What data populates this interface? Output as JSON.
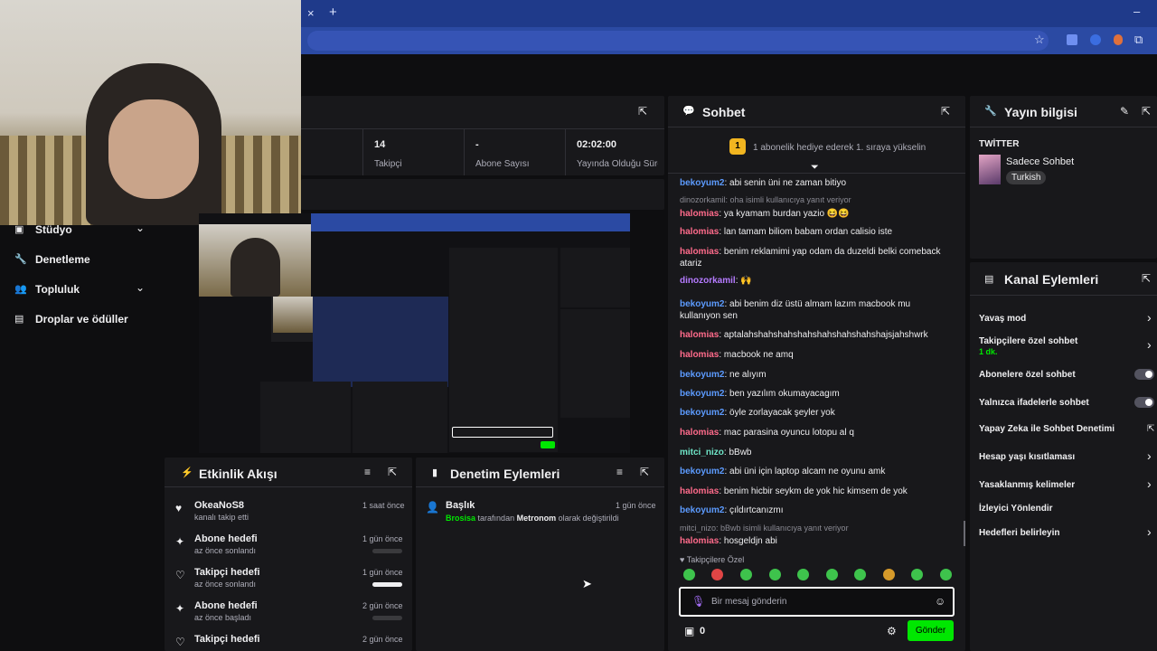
{
  "browser": {
    "close_tab": "×",
    "new_tab": "+",
    "minimize": "–"
  },
  "stats": [
    {
      "value": "14",
      "label": "Takipçi"
    },
    {
      "value": "-",
      "label": "Abone Sayısı"
    },
    {
      "value": "02:02:00",
      "label": "Yayında Olduğu Süre"
    }
  ],
  "sidebar": {
    "items": [
      {
        "label": "Stüdyo",
        "icon": "studio-icon",
        "has_chevron": true
      },
      {
        "label": "Denetleme",
        "icon": "wrench-icon",
        "has_chevron": false
      },
      {
        "label": "Topluluk",
        "icon": "community-icon",
        "has_chevron": true
      },
      {
        "label": "Droplar ve ödüller",
        "icon": "drops-icon",
        "has_chevron": false
      }
    ]
  },
  "activity": {
    "title": "Etkinlik Akışı",
    "items": [
      {
        "title": "OkeaNoS8",
        "sub": "kanalı takip etti",
        "time": "1 saat önce",
        "icon": "heart-icon",
        "progress": null
      },
      {
        "title": "Abone hedefi",
        "sub": "az önce sonlandı",
        "time": "1 gün önce",
        "icon": "sparkle-icon",
        "progress": 0
      },
      {
        "title": "Takipçi hedefi",
        "sub": "az önce sonlandı",
        "time": "1 gün önce",
        "icon": "heart-outline-icon",
        "progress": 1
      },
      {
        "title": "Abone hedefi",
        "sub": "az önce başladı",
        "time": "2 gün önce",
        "icon": "sparkle-icon",
        "progress": 0
      },
      {
        "title": "Takipçi hedefi",
        "sub": "",
        "time": "2 gün önce",
        "icon": "heart-outline-icon",
        "progress": null
      }
    ]
  },
  "moderation": {
    "title": "Denetim Eylemleri",
    "item": {
      "title": "Başlık",
      "user": "Brosisa",
      "text1": "tarafından",
      "user2": "Metronom",
      "text2": "olarak değiştirildi",
      "time": "1 gün önce"
    }
  },
  "chat": {
    "title": "Sohbet",
    "pinned_badge": "1",
    "pinned": "1 abonelik hediye ederek 1. sıraya yükselin",
    "lines": [
      {
        "user": "bekoyum2",
        "color": "#5c9bff",
        "text": "abi senin üni ne zaman bitiyo"
      },
      {
        "system": "dinozorkamil: oha isimli kullanıcıya yanıt veriyor"
      },
      {
        "user": "halomias",
        "color": "#ff6b8b",
        "text": "ya kyamam burdan yazio 😆😆"
      },
      {
        "user": "halomias",
        "color": "#ff6b8b",
        "text": "lan tamam biliom babam ordan calisio iste"
      },
      {
        "user": "halomias",
        "color": "#ff6b8b",
        "text": "benim reklamimi yap odam da duzeldi belki comeback atariz"
      },
      {
        "user": "dinozorkamil",
        "color": "#b57bff",
        "text": "🙌"
      },
      {
        "user": "bekoyum2",
        "color": "#5c9bff",
        "text": "abi benim diz üstü almam lazım macbook mu kullanıyon sen"
      },
      {
        "user": "halomias",
        "color": "#ff6b8b",
        "text": "aptalahshahshahshahshahshahshahshajsjahshwrk"
      },
      {
        "user": "halomias",
        "color": "#ff6b8b",
        "text": "macbook ne amq"
      },
      {
        "user": "bekoyum2",
        "color": "#5c9bff",
        "text": "ne alıyım"
      },
      {
        "user": "bekoyum2",
        "color": "#5c9bff",
        "text": "ben yazılım okumayacagım"
      },
      {
        "user": "bekoyum2",
        "color": "#5c9bff",
        "text": "öyle zorlayacak şeyler yok"
      },
      {
        "user": "halomias",
        "color": "#ff6b8b",
        "text": "mac parasina oyuncu lotopu al q"
      },
      {
        "user": "mitci_nizo",
        "color": "#6fe6c8",
        "text": "bBwb"
      },
      {
        "user": "bekoyum2",
        "color": "#5c9bff",
        "text": "abi üni için laptop alcam ne oyunu amk"
      },
      {
        "user": "halomias",
        "color": "#ff6b8b",
        "text": "benim hicbir seykm de yok hic kimsem de yok"
      },
      {
        "user": "bekoyum2",
        "color": "#5c9bff",
        "text": "çıldırtcanızmı"
      },
      {
        "system": "mitci_nizo: bBwb isimli kullanıcıya yanıt veriyor"
      },
      {
        "user": "halomias",
        "color": "#ff6b8b",
        "text": "hosgeldjn abi"
      }
    ],
    "emote_section": "Takipçilere Özel",
    "placeholder": "Bir mesaj gönderin",
    "points": "0",
    "send": "Gönder"
  },
  "stream_info": {
    "title": "Yayın bilgisi",
    "category_label": "TWİTTER",
    "stream_title": "Sadece Sohbet",
    "tag": "Turkish"
  },
  "channel_actions": {
    "title": "Kanal Eylemleri",
    "items": [
      {
        "label": "Yavaş mod",
        "note": "",
        "control": "arrow"
      },
      {
        "label": "Takipçilere özel sohbet",
        "note": "1 dk.",
        "control": "arrow"
      },
      {
        "label": "Abonelere özel sohbet",
        "note": "",
        "control": "toggle"
      },
      {
        "label": "Yalnızca ifadelerle sohbet",
        "note": "",
        "control": "toggle"
      },
      {
        "label": "Yapay Zeka ile Sohbet Denetimi",
        "note": "",
        "control": "external"
      },
      {
        "label": "Hesap yaşı kısıtlaması",
        "note": "",
        "control": "arrow"
      },
      {
        "label": "Yasaklanmış kelimeler",
        "note": "",
        "control": "arrow"
      },
      {
        "label": "İzleyici Yönlendir",
        "note": "",
        "control": "none"
      },
      {
        "label": "Hedefleri belirleyin",
        "note": "",
        "control": "arrow"
      }
    ]
  },
  "colors": {
    "accent": "#00e701",
    "bg": "#0e0e10",
    "panel": "#18181b",
    "note_green": "#00e701"
  }
}
